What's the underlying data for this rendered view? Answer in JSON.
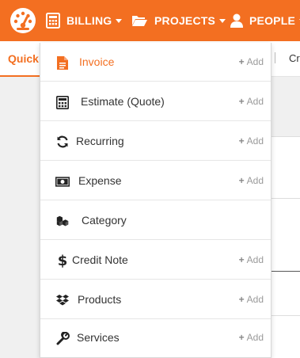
{
  "navbar": {
    "items": [
      {
        "label": "BILLING",
        "icon": "calculator-icon"
      },
      {
        "label": "PROJECTS",
        "icon": "folder-open-icon"
      },
      {
        "label": "PEOPLE",
        "icon": "user-icon"
      }
    ],
    "logo": "dashboard-gauge-icon",
    "color": "#f36f21"
  },
  "subbar": {
    "quick_label": "Quick",
    "right_fragment": "Cr"
  },
  "billing_menu": {
    "items": [
      {
        "label": "Invoice",
        "icon": "file-text-icon",
        "add": "Add",
        "active": true
      },
      {
        "label": "Estimate (Quote)",
        "icon": "calculator-icon",
        "add": "Add"
      },
      {
        "label": "Recurring",
        "icon": "refresh-icon",
        "add": "Add"
      },
      {
        "label": "Expense",
        "icon": "money-bill-icon",
        "add": "Add"
      },
      {
        "label": "Category",
        "icon": "cubes-icon"
      },
      {
        "label": "Credit Note",
        "icon": "dollar-icon",
        "add": "Add"
      },
      {
        "label": "Products",
        "icon": "dropbox-icon",
        "add": "Add"
      },
      {
        "label": "Services",
        "icon": "wrench-icon",
        "add": "Add"
      }
    ]
  }
}
